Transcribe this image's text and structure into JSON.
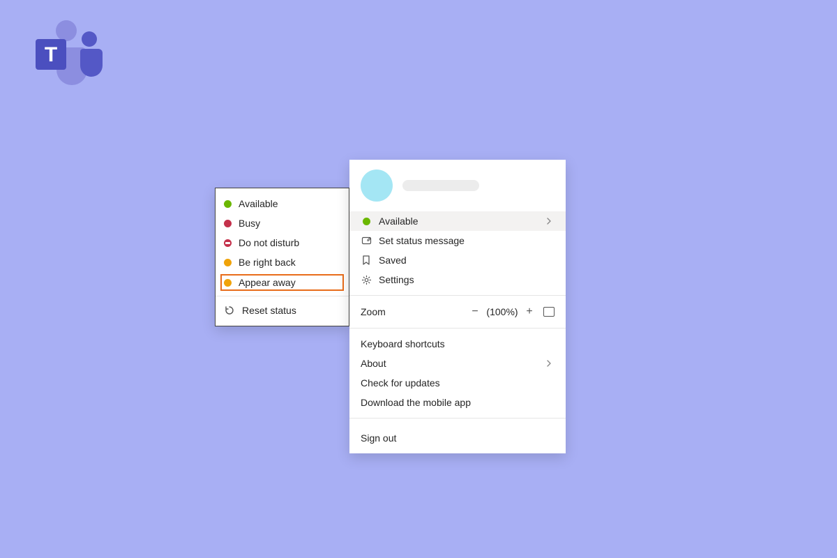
{
  "status_menu": {
    "available": "Available",
    "busy": "Busy",
    "dnd": "Do not disturb",
    "brb": "Be right back",
    "appear_away": "Appear away",
    "reset": "Reset status"
  },
  "user_menu": {
    "status_current": "Available",
    "set_status_msg": "Set status message",
    "saved": "Saved",
    "settings": "Settings",
    "zoom_label": "Zoom",
    "zoom_pct": "(100%)",
    "keyboard_shortcuts": "Keyboard shortcuts",
    "about": "About",
    "check_updates": "Check for updates",
    "download_app": "Download the mobile app",
    "sign_out": "Sign out"
  }
}
